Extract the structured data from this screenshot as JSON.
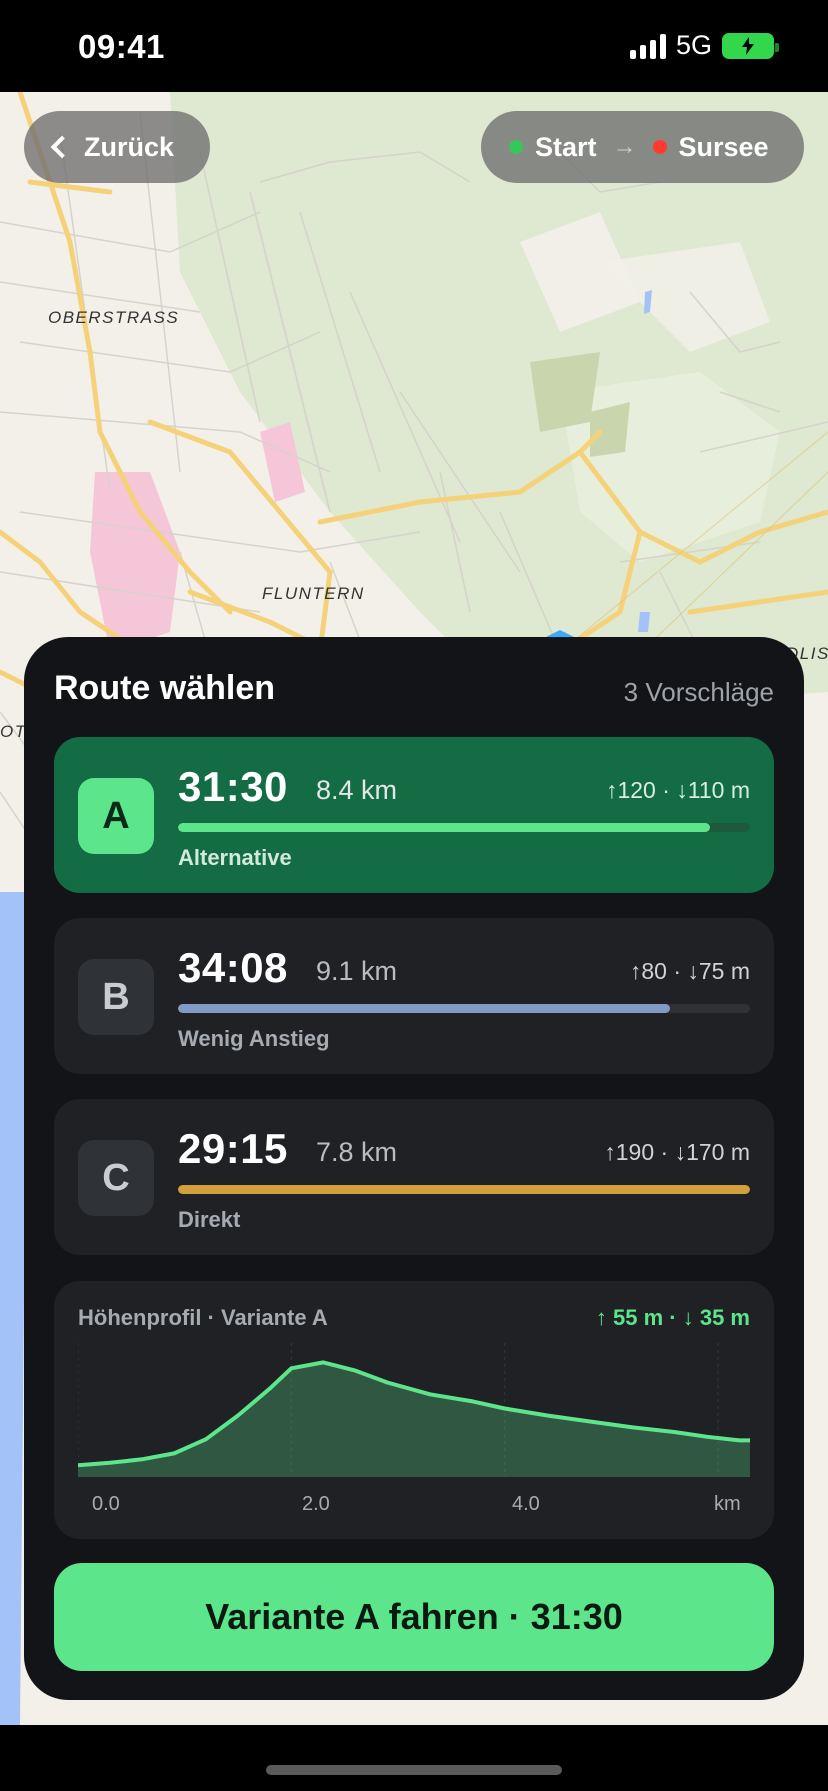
{
  "status_bar": {
    "time": "09:41",
    "network": "5G"
  },
  "map": {
    "labels": [
      "OBERSTRASS",
      "FLUNTERN",
      "DLIS",
      "OT"
    ]
  },
  "nav": {
    "back_label": "Zurück",
    "start_label": "Start",
    "arrow": "→",
    "destination_label": "Sursee",
    "start_color": "#34c759",
    "destination_color": "#ff3b30"
  },
  "sheet": {
    "title": "Route wählen",
    "count": "3 Vorschläge",
    "routes": [
      {
        "letter": "A",
        "time": "31:30",
        "distance": "8.4 km",
        "elevation": "↑120 · ↓110 m",
        "name": "Alternative",
        "color": "#5ce58b",
        "fill_fraction": 0.93,
        "selected": true
      },
      {
        "letter": "B",
        "time": "34:08",
        "distance": "9.1 km",
        "elevation": "↑80 · ↓75 m",
        "name": "Wenig Anstieg",
        "color": "#7f9cc4",
        "fill_fraction": 0.86,
        "selected": false
      },
      {
        "letter": "C",
        "time": "29:15",
        "distance": "7.8 km",
        "elevation": "↑190 · ↓170 m",
        "name": "Direkt",
        "color": "#d4a03f",
        "fill_fraction": 1.0,
        "selected": false
      }
    ],
    "elevation": {
      "title": "Höhenprofil · Variante A",
      "stats": "↑ 55 m  ·  ↓ 35 m",
      "ticks": [
        "0.0",
        "2.0",
        "4.0",
        "km"
      ]
    },
    "go_button": "Variante A fahren · 31:30"
  },
  "chart_data": {
    "type": "area",
    "x": [
      0.0,
      0.3,
      0.6,
      0.9,
      1.2,
      1.5,
      1.8,
      2.0,
      2.3,
      2.6,
      2.9,
      3.3,
      3.7,
      4.0,
      4.4,
      4.8,
      5.2,
      5.6,
      5.9,
      6.2,
      6.3
    ],
    "series": [
      {
        "values": [
          10,
          12,
          15,
          20,
          32,
          52,
          75,
          92,
          97,
          90,
          80,
          70,
          64,
          58,
          52,
          47,
          42,
          38,
          34,
          31,
          31
        ]
      }
    ],
    "xlim": [
      0,
      6.3
    ],
    "ylim": [
      0,
      110
    ],
    "grid": true,
    "color": "#5ce58b"
  }
}
